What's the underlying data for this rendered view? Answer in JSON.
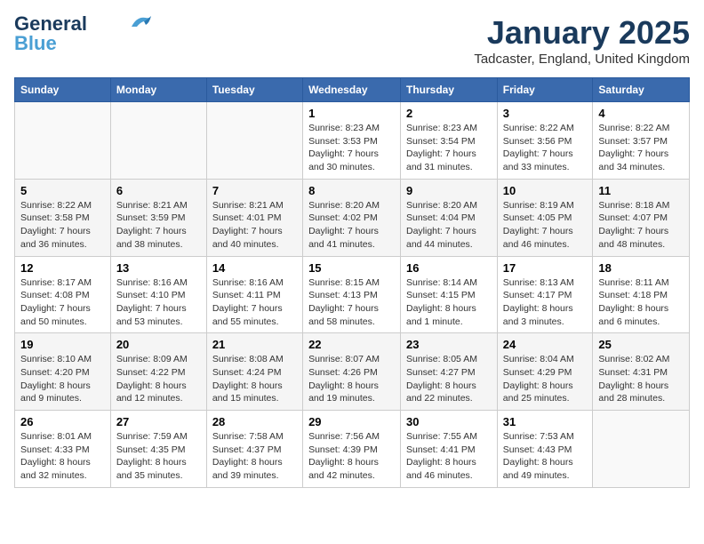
{
  "header": {
    "logo_line1": "General",
    "logo_line2": "Blue",
    "month_title": "January 2025",
    "location": "Tadcaster, England, United Kingdom"
  },
  "weekdays": [
    "Sunday",
    "Monday",
    "Tuesday",
    "Wednesday",
    "Thursday",
    "Friday",
    "Saturday"
  ],
  "weeks": [
    [
      {
        "day": "",
        "info": ""
      },
      {
        "day": "",
        "info": ""
      },
      {
        "day": "",
        "info": ""
      },
      {
        "day": "1",
        "info": "Sunrise: 8:23 AM\nSunset: 3:53 PM\nDaylight: 7 hours\nand 30 minutes."
      },
      {
        "day": "2",
        "info": "Sunrise: 8:23 AM\nSunset: 3:54 PM\nDaylight: 7 hours\nand 31 minutes."
      },
      {
        "day": "3",
        "info": "Sunrise: 8:22 AM\nSunset: 3:56 PM\nDaylight: 7 hours\nand 33 minutes."
      },
      {
        "day": "4",
        "info": "Sunrise: 8:22 AM\nSunset: 3:57 PM\nDaylight: 7 hours\nand 34 minutes."
      }
    ],
    [
      {
        "day": "5",
        "info": "Sunrise: 8:22 AM\nSunset: 3:58 PM\nDaylight: 7 hours\nand 36 minutes."
      },
      {
        "day": "6",
        "info": "Sunrise: 8:21 AM\nSunset: 3:59 PM\nDaylight: 7 hours\nand 38 minutes."
      },
      {
        "day": "7",
        "info": "Sunrise: 8:21 AM\nSunset: 4:01 PM\nDaylight: 7 hours\nand 40 minutes."
      },
      {
        "day": "8",
        "info": "Sunrise: 8:20 AM\nSunset: 4:02 PM\nDaylight: 7 hours\nand 41 minutes."
      },
      {
        "day": "9",
        "info": "Sunrise: 8:20 AM\nSunset: 4:04 PM\nDaylight: 7 hours\nand 44 minutes."
      },
      {
        "day": "10",
        "info": "Sunrise: 8:19 AM\nSunset: 4:05 PM\nDaylight: 7 hours\nand 46 minutes."
      },
      {
        "day": "11",
        "info": "Sunrise: 8:18 AM\nSunset: 4:07 PM\nDaylight: 7 hours\nand 48 minutes."
      }
    ],
    [
      {
        "day": "12",
        "info": "Sunrise: 8:17 AM\nSunset: 4:08 PM\nDaylight: 7 hours\nand 50 minutes."
      },
      {
        "day": "13",
        "info": "Sunrise: 8:16 AM\nSunset: 4:10 PM\nDaylight: 7 hours\nand 53 minutes."
      },
      {
        "day": "14",
        "info": "Sunrise: 8:16 AM\nSunset: 4:11 PM\nDaylight: 7 hours\nand 55 minutes."
      },
      {
        "day": "15",
        "info": "Sunrise: 8:15 AM\nSunset: 4:13 PM\nDaylight: 7 hours\nand 58 minutes."
      },
      {
        "day": "16",
        "info": "Sunrise: 8:14 AM\nSunset: 4:15 PM\nDaylight: 8 hours\nand 1 minute."
      },
      {
        "day": "17",
        "info": "Sunrise: 8:13 AM\nSunset: 4:17 PM\nDaylight: 8 hours\nand 3 minutes."
      },
      {
        "day": "18",
        "info": "Sunrise: 8:11 AM\nSunset: 4:18 PM\nDaylight: 8 hours\nand 6 minutes."
      }
    ],
    [
      {
        "day": "19",
        "info": "Sunrise: 8:10 AM\nSunset: 4:20 PM\nDaylight: 8 hours\nand 9 minutes."
      },
      {
        "day": "20",
        "info": "Sunrise: 8:09 AM\nSunset: 4:22 PM\nDaylight: 8 hours\nand 12 minutes."
      },
      {
        "day": "21",
        "info": "Sunrise: 8:08 AM\nSunset: 4:24 PM\nDaylight: 8 hours\nand 15 minutes."
      },
      {
        "day": "22",
        "info": "Sunrise: 8:07 AM\nSunset: 4:26 PM\nDaylight: 8 hours\nand 19 minutes."
      },
      {
        "day": "23",
        "info": "Sunrise: 8:05 AM\nSunset: 4:27 PM\nDaylight: 8 hours\nand 22 minutes."
      },
      {
        "day": "24",
        "info": "Sunrise: 8:04 AM\nSunset: 4:29 PM\nDaylight: 8 hours\nand 25 minutes."
      },
      {
        "day": "25",
        "info": "Sunrise: 8:02 AM\nSunset: 4:31 PM\nDaylight: 8 hours\nand 28 minutes."
      }
    ],
    [
      {
        "day": "26",
        "info": "Sunrise: 8:01 AM\nSunset: 4:33 PM\nDaylight: 8 hours\nand 32 minutes."
      },
      {
        "day": "27",
        "info": "Sunrise: 7:59 AM\nSunset: 4:35 PM\nDaylight: 8 hours\nand 35 minutes."
      },
      {
        "day": "28",
        "info": "Sunrise: 7:58 AM\nSunset: 4:37 PM\nDaylight: 8 hours\nand 39 minutes."
      },
      {
        "day": "29",
        "info": "Sunrise: 7:56 AM\nSunset: 4:39 PM\nDaylight: 8 hours\nand 42 minutes."
      },
      {
        "day": "30",
        "info": "Sunrise: 7:55 AM\nSunset: 4:41 PM\nDaylight: 8 hours\nand 46 minutes."
      },
      {
        "day": "31",
        "info": "Sunrise: 7:53 AM\nSunset: 4:43 PM\nDaylight: 8 hours\nand 49 minutes."
      },
      {
        "day": "",
        "info": ""
      }
    ]
  ]
}
